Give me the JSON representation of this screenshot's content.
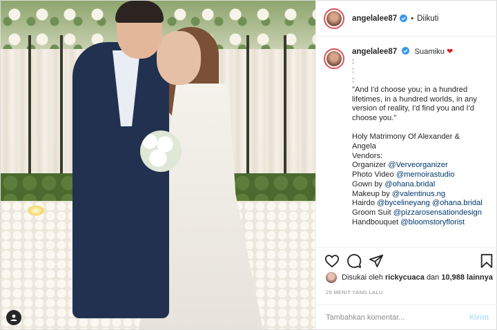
{
  "post": {
    "username": "angelalee87",
    "follow_separator": "•",
    "follow_status": "Diikuti"
  },
  "caption": {
    "username": "angelalee87",
    "first_line": "Suamiku",
    "heart": "❤",
    "lines": [
      ":",
      ":",
      ":",
      "\"And I'd choose you; in a hundred",
      "lifetimes, in a hundred worlds, in any",
      "version of reality, I'd find you and I'd",
      "choose you.\"",
      "",
      "Holy Matrimony Of Alexander &",
      "Angela",
      "Vendors:"
    ],
    "vendors": [
      {
        "label": "Organizer",
        "mention": "@Verveorganizer"
      },
      {
        "label": "Photo Video",
        "mention": "@memoirastudio"
      },
      {
        "label": "Gown by",
        "mention": "@ohana.bridal"
      },
      {
        "label": "Makeup by",
        "mention": "@valentinus.ng"
      },
      {
        "label": "Hairdo",
        "mention": "@bycelineyang",
        "mention2": "@ohana.bridal"
      },
      {
        "label": "Groom Suit",
        "mention": "@pizzarosensationdesign"
      },
      {
        "label": "Handbouquet",
        "mention": "@bloomstoryflorist"
      }
    ]
  },
  "likes": {
    "prefix": "Disukai oleh",
    "user": "rickycuaca",
    "joiner": "dan",
    "count": "10,988 lainnya"
  },
  "timestamp": "26 MENIT YANG LALU",
  "comment": {
    "placeholder": "Tambahkan komentar...",
    "post_label": "Kirim"
  },
  "icons": {
    "like": "heart-outline-icon",
    "comment": "speech-bubble-icon",
    "share": "paper-plane-icon",
    "save": "bookmark-icon",
    "verified": "verified-badge-icon",
    "user_tags": "user-tag-icon"
  },
  "colors": {
    "verified": "#3897f0",
    "mention": "#00376b",
    "heart": "#d6202b",
    "avatar_ring": "#d94f58",
    "post_button_disabled": "#b2dffc"
  }
}
